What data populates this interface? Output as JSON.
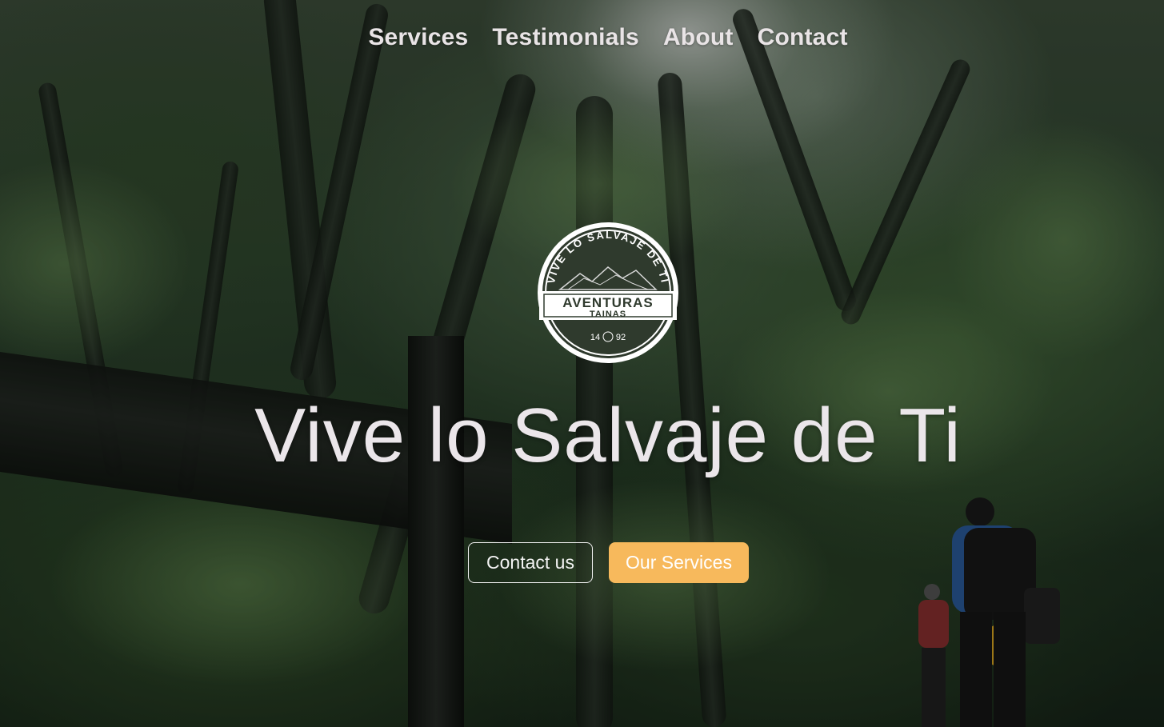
{
  "nav": {
    "items": [
      {
        "label": "Services"
      },
      {
        "label": "Testimonials"
      },
      {
        "label": "About"
      },
      {
        "label": "Contact"
      }
    ]
  },
  "logo": {
    "arc_text": "VIVE LO SALVAJE DE TI",
    "brand_top": "AVENTURAS",
    "brand_bottom": "TAINAS",
    "year_left": "14",
    "year_right": "92"
  },
  "hero": {
    "headline": "Vive lo Salvaje de Ti",
    "background_icon": "rainforest-photo"
  },
  "cta": {
    "contact_label": "Contact us",
    "services_label": "Our Services"
  },
  "colors": {
    "accent": "#f7b95c",
    "text": "#ebe6ea"
  }
}
